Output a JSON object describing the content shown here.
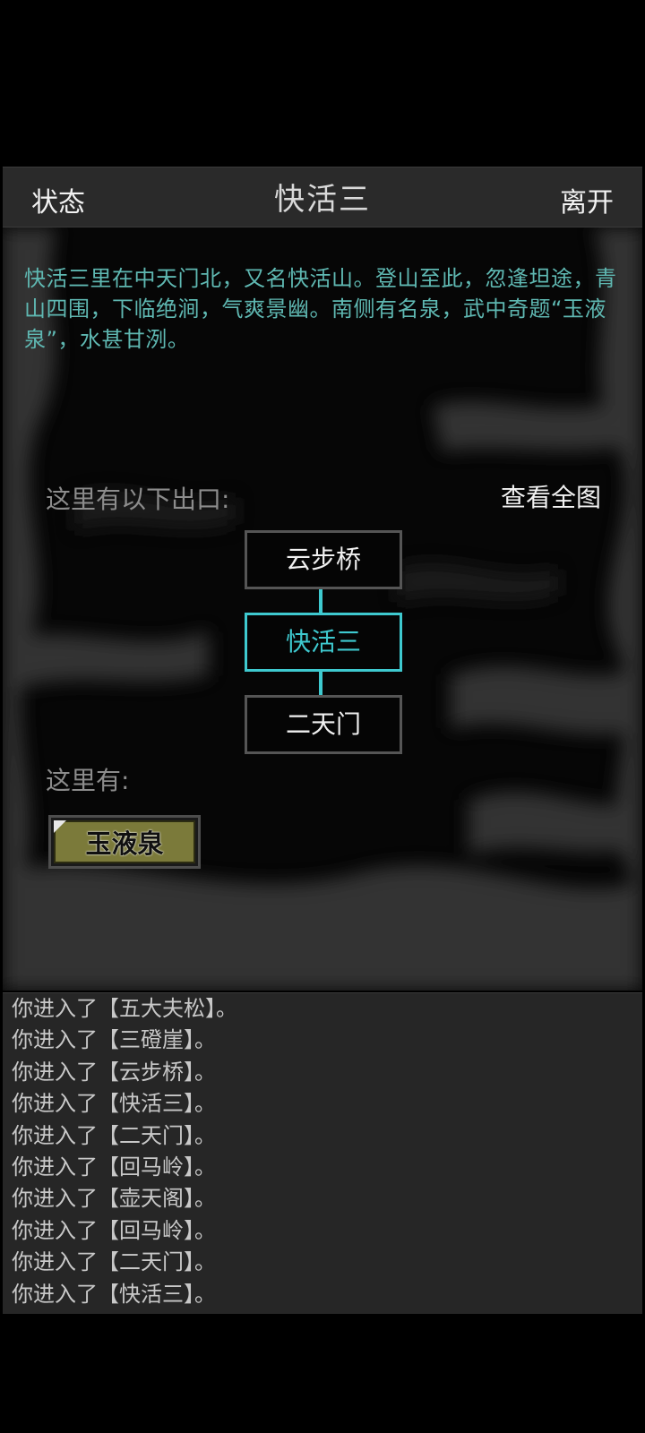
{
  "header": {
    "status_label": "状态",
    "title": "快活三",
    "leave_label": "离开"
  },
  "location": {
    "description": "快活三里在中天门北，又名快活山。登山至此，忽逢坦途，青山四围，下临绝涧，气爽景幽。南侧有名泉，武中奇题“玉液泉”，水甚甘洌。",
    "exits_label": "这里有以下出口:",
    "full_map_label": "查看全图",
    "exits": {
      "north": "云步桥",
      "current": "快活三",
      "south": "二天门"
    },
    "here_label": "这里有:",
    "items": [
      "玉液泉"
    ]
  },
  "log": [
    "你进入了【五大夫松】。",
    "你进入了【三磴崖】。",
    "你进入了【云步桥】。",
    "你进入了【快活三】。",
    "你进入了【二天门】。",
    "你进入了【回马岭】。",
    "你进入了【壶天阁】。",
    "你进入了【回马岭】。",
    "你进入了【二天门】。",
    "你进入了【快活三】。"
  ],
  "colors": {
    "accent": "#3ec9cf",
    "description_text": "#5fb8b2",
    "item_button": "#7b7a3a",
    "panel": "#2a2a2a"
  }
}
